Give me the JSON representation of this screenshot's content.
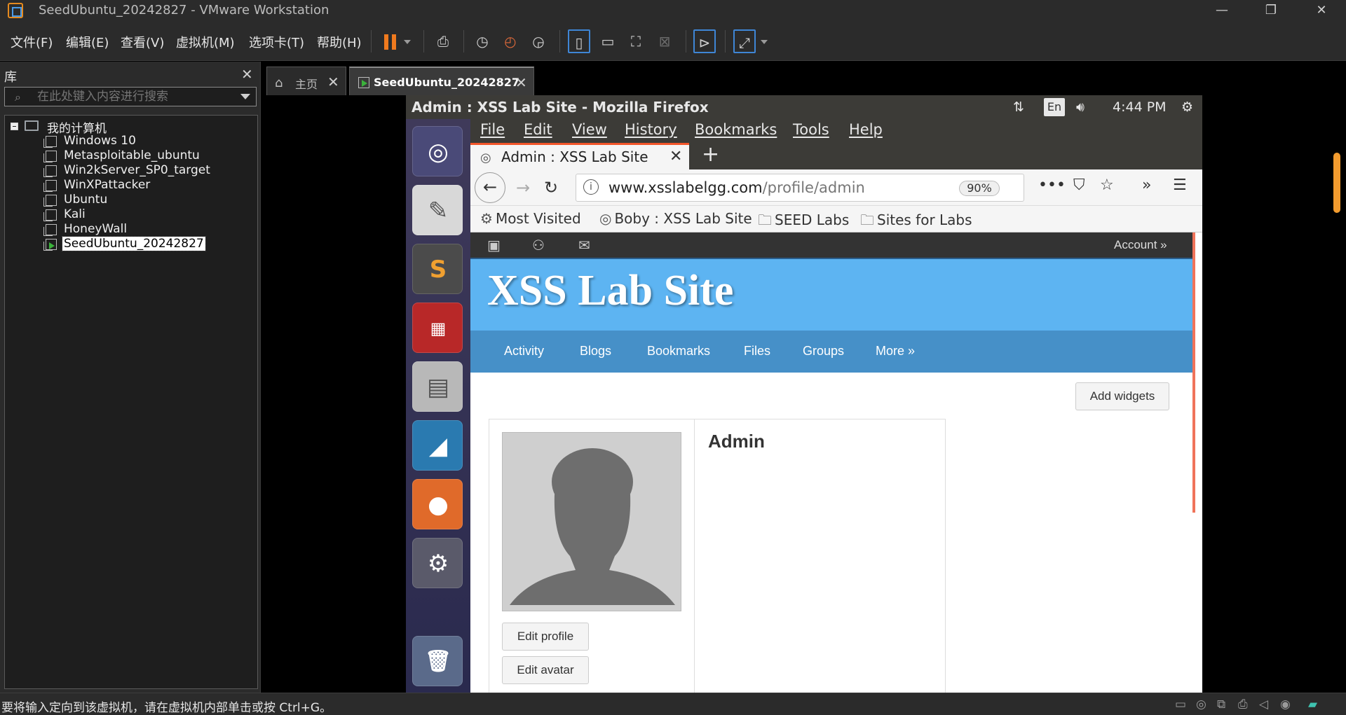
{
  "window": {
    "title": "SeedUbuntu_20242827 - VMware Workstation",
    "controls": [
      "—",
      "❐",
      "✕"
    ]
  },
  "menu": [
    "文件(F)",
    "编辑(E)",
    "查看(V)",
    "虚拟机(M)",
    "选项卡(T)",
    "帮助(H)"
  ],
  "library": {
    "title": "库",
    "close": "✕",
    "search_placeholder": "在此处键入内容进行搜索",
    "root": "我的计算机",
    "vms": [
      "Windows 10",
      "Metasploitable_ubuntu",
      "Win2kServer_SP0_target",
      "WinXPattacker",
      "Ubuntu",
      "Kali",
      "HoneyWall",
      "SeedUbuntu_20242827"
    ],
    "selected": "SeedUbuntu_20242827"
  },
  "tabs": [
    {
      "label": "主页",
      "close": "✕"
    },
    {
      "label": "SeedUbuntu_20242827",
      "close": "✕"
    }
  ],
  "guest": {
    "window_title": "Admin : XSS Lab Site - Mozilla Firefox",
    "keyboard": "En",
    "clock": "4:44 PM",
    "firefox": {
      "menu": [
        "File",
        "Edit",
        "View",
        "History",
        "Bookmarks",
        "Tools",
        "Help"
      ],
      "tab_title": "Admin : XSS Lab Site",
      "tab_close": "✕",
      "new_tab": "+",
      "url_domain": "www.xsslabelgg.com",
      "url_path": "/profile/admin",
      "zoom": "90%",
      "bookmarks": [
        "Most Visited",
        "Boby : XSS Lab Site",
        "SEED Labs",
        "Sites for Labs"
      ]
    },
    "site": {
      "account": "Account »",
      "name": "XSS Lab Site",
      "nav": [
        "Activity",
        "Blogs",
        "Bookmarks",
        "Files",
        "Groups",
        "More »"
      ],
      "add_widgets": "Add widgets",
      "profile_name": "Admin",
      "edit_profile": "Edit profile",
      "edit_avatar": "Edit avatar"
    }
  },
  "status_message": "要将输入定向到该虚拟机，请在虚拟机内部单击或按 Ctrl+G。",
  "colors": {
    "accent_orange": "#f07a1e",
    "site_header": "#5db4f2",
    "site_nav": "#4690c8"
  }
}
